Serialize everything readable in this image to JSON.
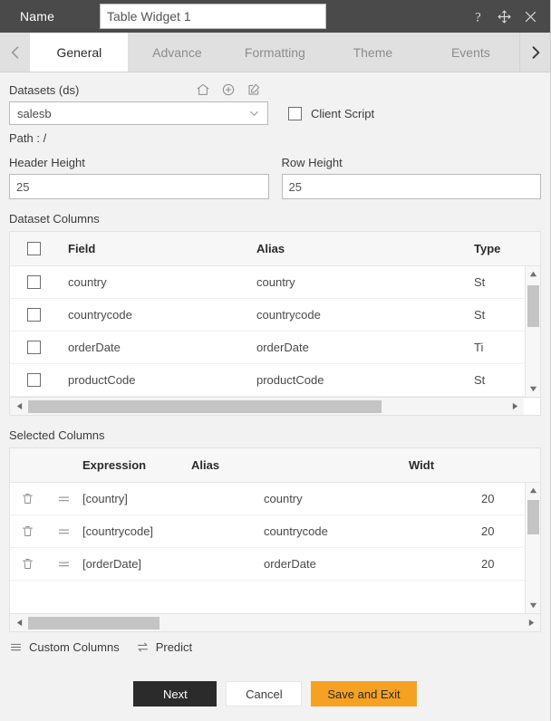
{
  "titlebar": {
    "name_label": "Name",
    "name_value": "Table Widget 1",
    "help_icon": "question-mark-icon",
    "move_icon": "move-icon",
    "close_icon": "close-icon"
  },
  "tabbar": {
    "prev_icon": "chevron-left-icon",
    "next_icon": "chevron-right-icon",
    "tabs": [
      {
        "label": "General",
        "active": true
      },
      {
        "label": "Advance",
        "active": false
      },
      {
        "label": "Formatting",
        "active": false
      },
      {
        "label": "Theme",
        "active": false
      },
      {
        "label": "Events",
        "active": false
      }
    ]
  },
  "datasets": {
    "label": "Datasets (ds)",
    "home_icon": "home-icon",
    "add_icon": "plus-circle-icon",
    "edit_icon": "edit-pencil-icon",
    "selected": "salesb",
    "chevron_icon": "chevron-down-icon",
    "client_script_label": "Client Script",
    "client_script_checked": false,
    "path_label": "Path :",
    "path_value": "/"
  },
  "heights": {
    "header_height_label": "Header Height",
    "header_height_value": "25",
    "row_height_label": "Row Height",
    "row_height_value": "25"
  },
  "dataset_columns": {
    "title": "Dataset Columns",
    "headers": [
      "Field",
      "Alias",
      "Type"
    ],
    "rows": [
      {
        "checked": false,
        "field": "country",
        "alias": "country",
        "type": "St"
      },
      {
        "checked": false,
        "field": "countrycode",
        "alias": "countrycode",
        "type": "St"
      },
      {
        "checked": false,
        "field": "orderDate",
        "alias": "orderDate",
        "type": "Ti"
      },
      {
        "checked": false,
        "field": "productCode",
        "alias": "productCode",
        "type": "St"
      }
    ]
  },
  "selected_columns": {
    "title": "Selected Columns",
    "headers": [
      "Expression",
      "Alias",
      "Widt"
    ],
    "rows": [
      {
        "delete_icon": "trash-icon",
        "handle_icon": "equals-icon",
        "expression": "[country]",
        "alias": "country",
        "width": "20"
      },
      {
        "delete_icon": "trash-icon",
        "handle_icon": "equals-icon",
        "expression": "[countrycode]",
        "alias": "countrycode",
        "width": "20"
      },
      {
        "delete_icon": "trash-icon",
        "handle_icon": "equals-icon",
        "expression": "[orderDate]",
        "alias": "orderDate",
        "width": "20"
      }
    ]
  },
  "links": {
    "custom_columns_label": "Custom Columns",
    "custom_columns_icon": "hamburger-icon",
    "predict_label": "Predict",
    "predict_icon": "swap-arrows-icon"
  },
  "footer": {
    "next_label": "Next",
    "cancel_label": "Cancel",
    "save_label": "Save and Exit"
  },
  "colors": {
    "titlebar_bg": "#4a4a4a",
    "accent_save": "#f5a122",
    "next_bg": "#2b2b2b",
    "tab_active_bg": "#ffffff",
    "tabbar_bg": "#e0e0e0"
  }
}
